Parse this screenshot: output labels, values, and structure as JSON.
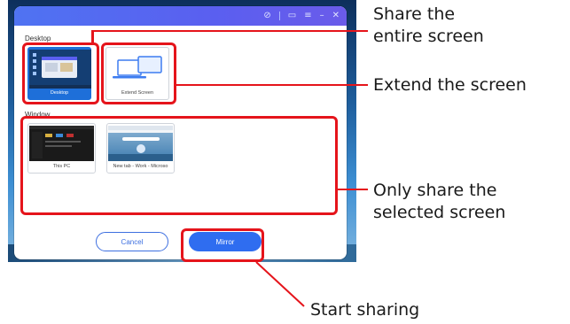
{
  "dialog": {
    "section_desktop": "Desktop",
    "section_window": "Window",
    "desktop_options": [
      {
        "label": "Desktop",
        "selected": true
      },
      {
        "label": "Extend Screen",
        "selected": false
      }
    ],
    "window_options": [
      {
        "label": "This PC"
      },
      {
        "label": "New tab - Work - Microso"
      }
    ],
    "cancel_label": "Cancel",
    "mirror_label": "Mirror",
    "titlebar_icons": [
      "link-icon",
      "screen-icon",
      "menu-icon",
      "minimize-icon",
      "close-icon"
    ]
  },
  "annotations": {
    "share_entire_line1": "Share the",
    "share_entire_line2": "entire screen",
    "extend": "Extend the screen",
    "only_share_line1": "Only share the",
    "only_share_line2": "selected screen",
    "start_sharing": "Start sharing"
  },
  "colors": {
    "highlight": "#e5141b",
    "accent": "#2f6df0",
    "titlebar": "#5a5ff0"
  }
}
